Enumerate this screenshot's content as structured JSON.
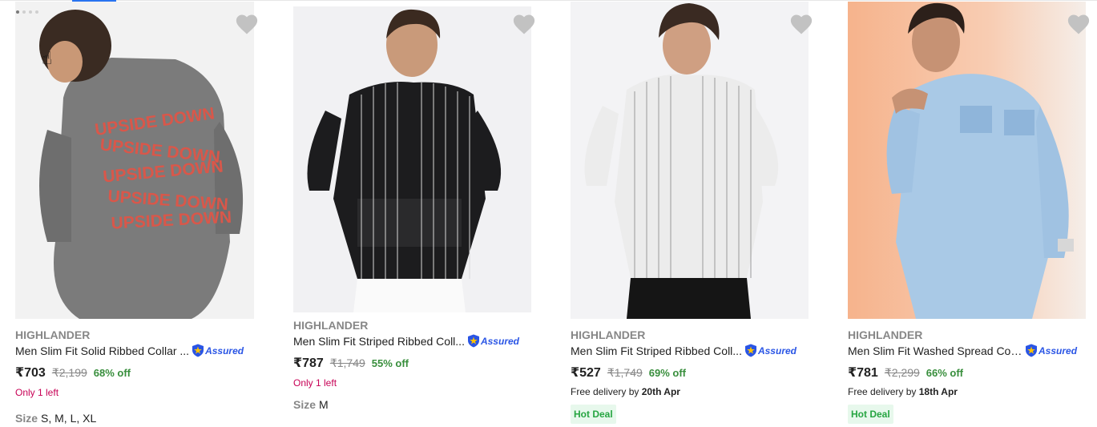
{
  "products": [
    {
      "brand": "HIGHLANDER",
      "title": "Men Slim Fit Solid Ribbed Collar ...",
      "assured": "Assured",
      "price": "₹703",
      "mrp": "₹2,199",
      "discount": "68% off",
      "stock": "Only 1 left",
      "size_label": "Size",
      "sizes": "S, M, L, XL",
      "image_colors": {
        "bg": "#f2f2f2",
        "garment": "#7b7b7b",
        "print": "#d9574a"
      },
      "image_text": "UPSIDE DOWN"
    },
    {
      "brand": "HIGHLANDER",
      "title": "Men Slim Fit Striped Ribbed Coll...",
      "assured": "Assured",
      "price": "₹787",
      "mrp": "₹1,749",
      "discount": "55% off",
      "stock": "Only 1 left",
      "size_label": "Size",
      "sizes": "M",
      "image_colors": {
        "bg": "#f1f1f3",
        "garment": "#1c1c1e",
        "print": "#e0e0e0"
      }
    },
    {
      "brand": "HIGHLANDER",
      "title": "Men Slim Fit Striped Ribbed Coll...",
      "assured": "Assured",
      "price": "₹527",
      "mrp": "₹1,749",
      "discount": "69% off",
      "delivery_prefix": "Free delivery by",
      "delivery_date": "20th Apr",
      "badge": "Hot Deal",
      "image_colors": {
        "bg": "#f3f3f5",
        "garment": "#ececec",
        "print": "#7e7e7e"
      }
    },
    {
      "brand": "HIGHLANDER",
      "title": "Men Slim Fit Washed Spread Col...",
      "assured": "Assured",
      "price": "₹781",
      "mrp": "₹2,299",
      "discount": "66% off",
      "delivery_prefix": "Free delivery by",
      "delivery_date": "18th Apr",
      "badge": "Hot Deal",
      "image_colors": {
        "bg": "#f6b38c",
        "garment": "#a9c9e6",
        "print": "#7fa9cf"
      }
    }
  ],
  "icons": {
    "wishlist": "heart-icon",
    "assured": "shield-icon",
    "cursor": "hand-pointer-icon"
  },
  "colors": {
    "discount": "#388e3c",
    "stock": "#c70055",
    "assured": "#2a55e5",
    "wish": "#c2c2c2",
    "hotdeal_bg": "#e7f8ec"
  }
}
